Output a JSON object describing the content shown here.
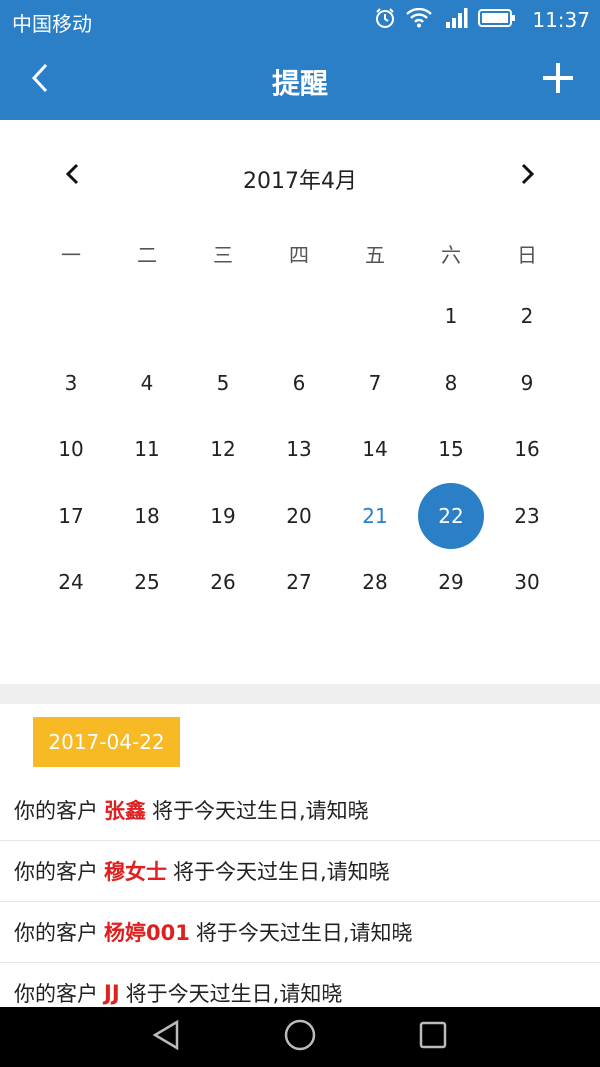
{
  "status_bar": {
    "carrier": "中国移动",
    "time": "11:37",
    "icons": [
      "alarm-icon",
      "wifi-icon",
      "signal-icon",
      "battery-icon"
    ]
  },
  "app_bar": {
    "title": "提醒",
    "back_icon": "back-icon",
    "add_icon": "add-icon"
  },
  "calendar": {
    "month_label": "2017年4月",
    "weekdays": [
      "一",
      "二",
      "三",
      "四",
      "五",
      "六",
      "日"
    ],
    "weeks": [
      [
        "",
        "",
        "",
        "",
        "",
        "1",
        "2"
      ],
      [
        "3",
        "4",
        "5",
        "6",
        "7",
        "8",
        "9"
      ],
      [
        "10",
        "11",
        "12",
        "13",
        "14",
        "15",
        "16"
      ],
      [
        "17",
        "18",
        "19",
        "20",
        "21",
        "22",
        "23"
      ],
      [
        "24",
        "25",
        "26",
        "27",
        "28",
        "29",
        "30"
      ]
    ],
    "today": "21",
    "selected": "22"
  },
  "reminders": {
    "date_badge": "2017-04-22",
    "items": [
      {
        "prefix": "你的客户",
        "name": "张鑫",
        "suffix": "将于今天过生日,请知晓"
      },
      {
        "prefix": "你的客户",
        "name": "穆女士",
        "suffix": "将于今天过生日,请知晓"
      },
      {
        "prefix": "你的客户",
        "name": "杨婷001",
        "suffix": "将于今天过生日,请知晓"
      },
      {
        "prefix": "你的客户",
        "name": "JJ",
        "suffix": "将于今天过生日,请知晓"
      }
    ]
  },
  "colors": {
    "primary": "#2a7fc6",
    "badge": "#f7b924",
    "name_red": "#e02020"
  }
}
